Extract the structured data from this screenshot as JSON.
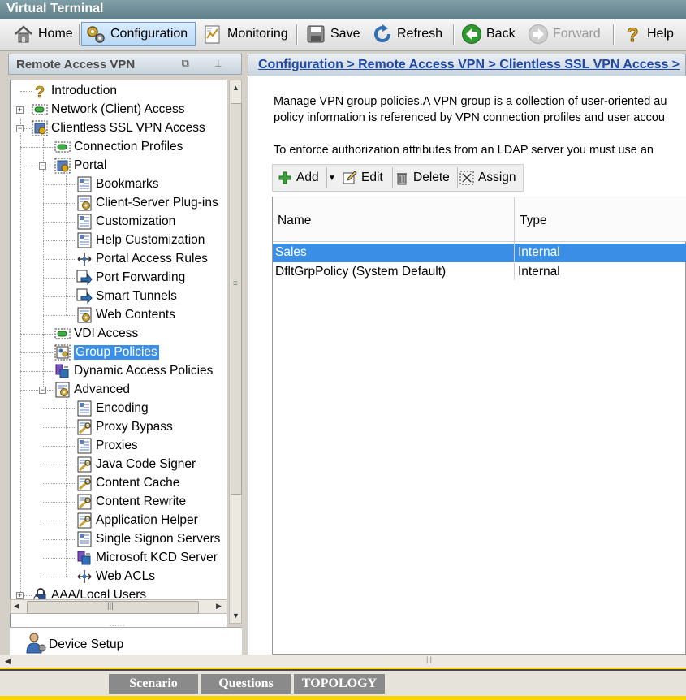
{
  "window": {
    "title": "Virtual Terminal"
  },
  "toolbar": {
    "home": "Home",
    "configuration": "Configuration",
    "monitoring": "Monitoring",
    "save": "Save",
    "refresh": "Refresh",
    "back": "Back",
    "forward": "Forward",
    "help": "Help"
  },
  "left_panel": {
    "title": "Remote Access VPN",
    "tree": [
      "Introduction",
      "Network (Client) Access",
      "Clientless SSL VPN Access",
      "Connection Profiles",
      "Portal",
      "Bookmarks",
      "Client-Server Plug-ins",
      "Customization",
      "Help Customization",
      "Portal Access Rules",
      "Port Forwarding",
      "Smart Tunnels",
      "Web Contents",
      "VDI Access",
      "Group Policies",
      "Dynamic Access Policies",
      "Advanced",
      "Encoding",
      "Proxy Bypass",
      "Proxies",
      "Java Code Signer",
      "Content Cache",
      "Content Rewrite",
      "Application Helper",
      "Single Signon Servers",
      "Microsoft KCD Server",
      "Web ACLs",
      "AAA/Local Users"
    ],
    "selected": "Group Policies",
    "device_setup": "Device Setup"
  },
  "main": {
    "breadcrumb": "Configuration > Remote Access VPN > Clientless SSL VPN Access >",
    "description_line1": "Manage VPN group policies.A VPN group is a collection of user-oriented au",
    "description_line2": "policy information is referenced by VPN connection profiles and user accou",
    "description_line3": "To enforce authorization attributes from an LDAP server you must use an",
    "actions": {
      "add": "Add",
      "edit": "Edit",
      "delete": "Delete",
      "assign": "Assign"
    },
    "table": {
      "columns": [
        "Name",
        "Type"
      ],
      "rows": [
        {
          "name": "Sales",
          "type": "Internal",
          "selected": true
        },
        {
          "name": "DfltGrpPolicy (System Default)",
          "type": "Internal",
          "selected": false
        }
      ]
    }
  },
  "bottom_tabs": {
    "scenario": "Scenario",
    "questions": "Questions",
    "topology": "TOPOLOGY"
  },
  "colors": {
    "selection": "#3a8ee6",
    "breadcrumb_link": "#1f48a8",
    "bottom_bar": "#ffd700"
  }
}
